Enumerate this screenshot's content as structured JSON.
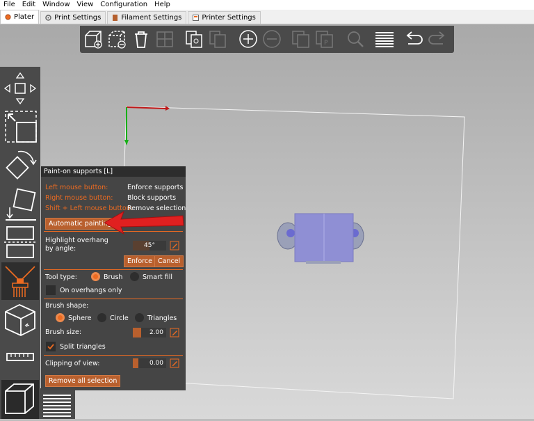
{
  "menu": [
    "File",
    "Edit",
    "Window",
    "View",
    "Configuration",
    "Help"
  ],
  "tabs": [
    {
      "label": "Plater",
      "active": true
    },
    {
      "label": "Print Settings",
      "active": false
    },
    {
      "label": "Filament Settings",
      "active": false
    },
    {
      "label": "Printer Settings",
      "active": false
    }
  ],
  "panel": {
    "title": "Paint-on supports [L]",
    "shortcuts": [
      {
        "key": "Left mouse button:",
        "action": "Enforce supports"
      },
      {
        "key": "Right mouse button:",
        "action": "Block supports"
      },
      {
        "key": "Shift + Left mouse button:",
        "action": "Remove selection"
      }
    ],
    "auto_paint_label": "Automatic painting",
    "highlight_label_1": "Highlight overhang",
    "highlight_label_2": "by angle:",
    "angle_value": "45°",
    "enforce_label": "Enforce",
    "cancel_label": "Cancel",
    "tool_type_label": "Tool type:",
    "tool_brush_label": "Brush",
    "tool_smartfill_label": "Smart fill",
    "on_overhangs_label": "On overhangs only",
    "brush_shape_label": "Brush shape:",
    "shape_sphere_label": "Sphere",
    "shape_circle_label": "Circle",
    "shape_triangles_label": "Triangles",
    "brush_size_label": "Brush size:",
    "brush_size_value": "2.00",
    "split_triangles_label": "Split triangles",
    "clipping_label": "Clipping of view:",
    "clipping_value": "0.00",
    "remove_all_label": "Remove all selection"
  },
  "colors": {
    "accent": "#ed6b21",
    "panel_bg": "#454545",
    "toolbar_bg": "#4a4a4a",
    "model": "#8f8fd4",
    "annotation_arrow": "#e02020"
  }
}
